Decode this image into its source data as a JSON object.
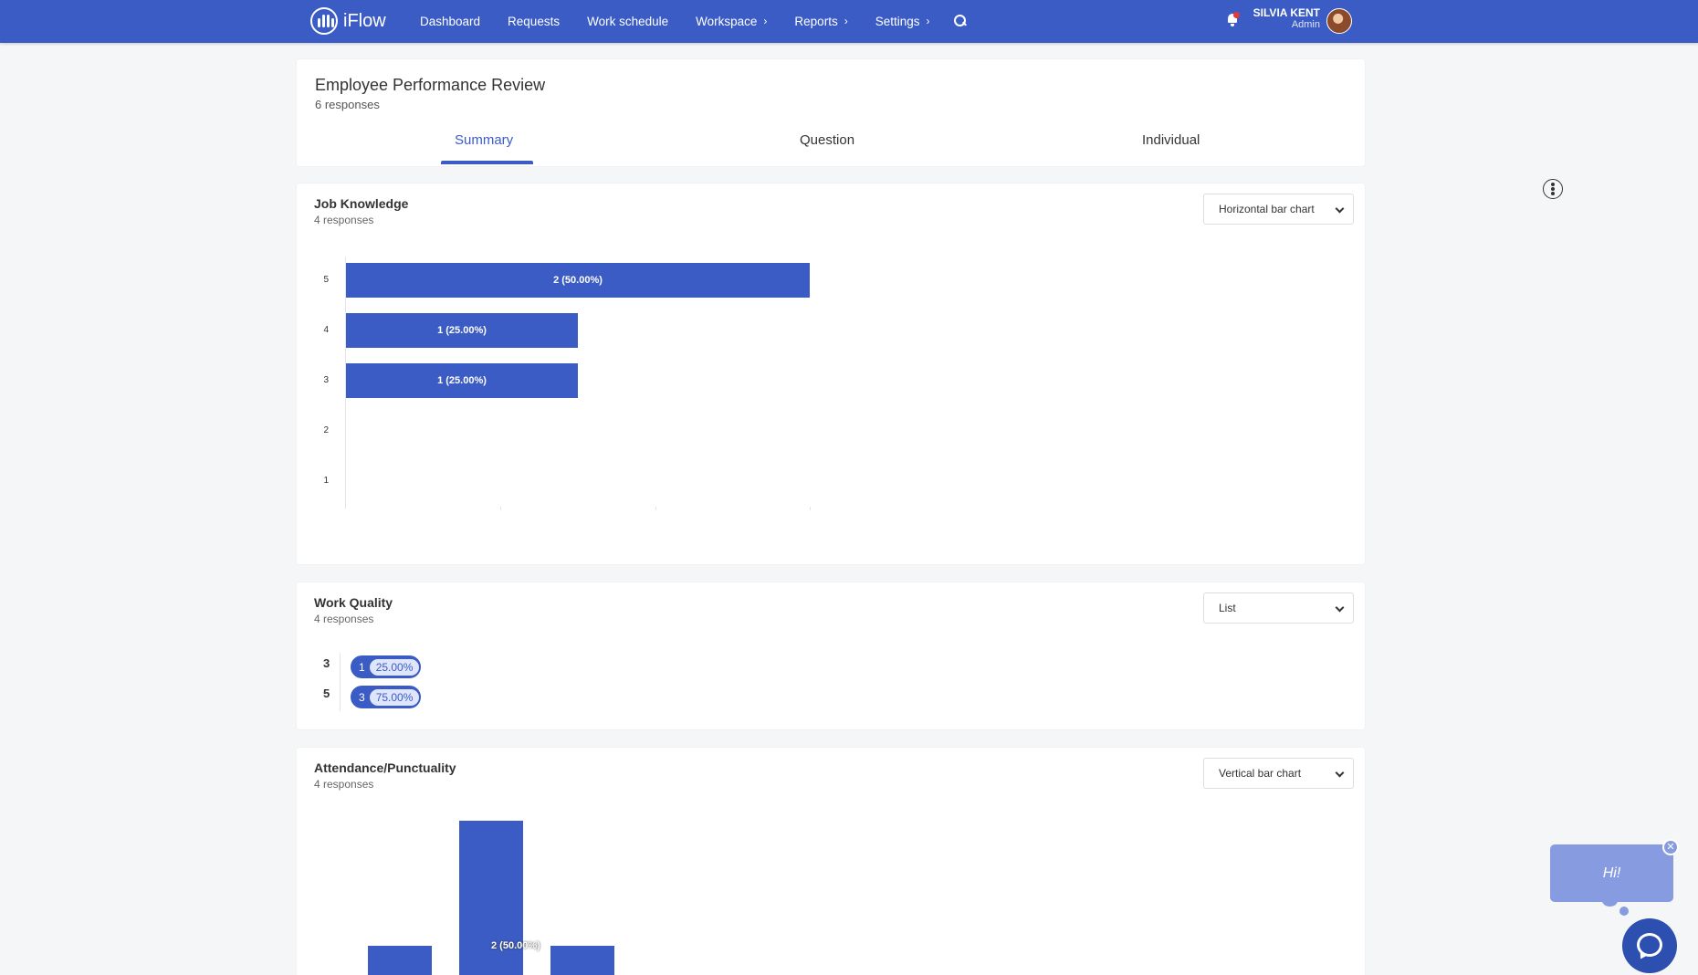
{
  "app": {
    "logo_text": "iFlow",
    "nav": [
      {
        "label": "Dashboard"
      },
      {
        "label": "Requests"
      },
      {
        "label": "Work schedule"
      },
      {
        "label": "Workspace",
        "chevron": "›"
      },
      {
        "label": "Reports",
        "chevron": "›"
      },
      {
        "label": "Settings",
        "chevron": "›"
      }
    ],
    "user": {
      "name": "SILVIA KENT",
      "role": "Admin"
    },
    "accent": "#3b5cc4"
  },
  "survey": {
    "title": "Employee Performance Review",
    "responses": "6 responses",
    "tabs": [
      {
        "label": "Summary",
        "active": true
      },
      {
        "label": "Question",
        "active": false
      },
      {
        "label": "Individual",
        "active": false
      }
    ]
  },
  "questions": [
    {
      "title": "Job Knowledge",
      "responses": "4 responses",
      "view": "Horizontal bar chart"
    },
    {
      "title": "Work Quality",
      "responses": "4 responses",
      "view": "List",
      "items": [
        {
          "key": "3",
          "count": "1",
          "pct": "25.00%"
        },
        {
          "key": "5",
          "count": "3",
          "pct": "75.00%"
        }
      ]
    },
    {
      "title": "Attendance/Punctuality",
      "responses": "4 responses",
      "view": "Vertical bar chart"
    }
  ],
  "chart_data": [
    {
      "type": "bar",
      "orientation": "horizontal",
      "categories": [
        "5",
        "4",
        "3",
        "2",
        "1"
      ],
      "values": [
        2,
        1,
        1,
        0,
        0
      ],
      "data_labels": [
        "2 (50.00%)",
        "1 (25.00%)",
        "1 (25.00%)",
        "",
        ""
      ],
      "xlim": [
        0,
        2
      ],
      "grid": false
    },
    {
      "type": "bar",
      "orientation": "vertical",
      "values": [
        1,
        2,
        1
      ],
      "data_labels": [
        "",
        "2 (50.00%)",
        ""
      ],
      "grid": false
    }
  ],
  "chat": {
    "greeting": "Hi!",
    "close": "✕"
  }
}
